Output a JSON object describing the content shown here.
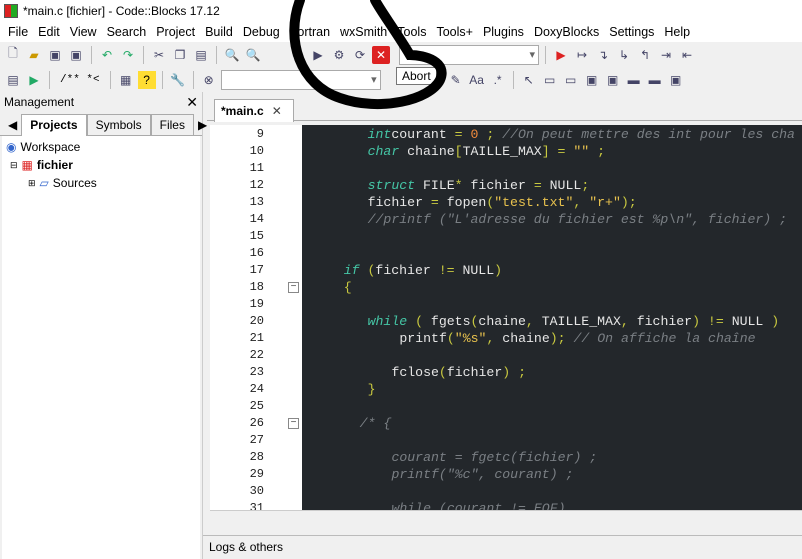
{
  "title": "*main.c [fichier] - Code::Blocks 17.12",
  "menu": [
    "File",
    "Edit",
    "View",
    "Search",
    "Project",
    "Build",
    "Debug",
    "Fortran",
    "wxSmith",
    "Tools",
    "Tools+",
    "Plugins",
    "DoxyBlocks",
    "Settings",
    "Help"
  ],
  "toolbar": {
    "doxy_comment": "/** *<",
    "tooltip": "Abort"
  },
  "management": {
    "title": "Management",
    "tabs": [
      "Projects",
      "Symbols",
      "Files"
    ],
    "tree": {
      "workspace": "Workspace",
      "project": "fichier",
      "folder": "Sources"
    }
  },
  "editor": {
    "tab": "*main.c",
    "lines": [
      {
        "n": "9",
        "indent": 8,
        "seg": [
          [
            "kw",
            "int"
          ],
          [
            "",
            "courant "
          ],
          [
            "pn",
            "= "
          ],
          [
            "num",
            "0"
          ],
          [
            "pn",
            " ; "
          ],
          [
            "com",
            "//On peut mettre des int pour les cha"
          ]
        ]
      },
      {
        "n": "10",
        "indent": 8,
        "seg": [
          [
            "kw",
            "char"
          ],
          [
            "",
            " chaine"
          ],
          [
            "pn",
            "["
          ],
          [
            "",
            "TAILLE_MAX"
          ],
          [
            "pn",
            "] = "
          ],
          [
            "str",
            "\"\""
          ],
          [
            "pn",
            " ;"
          ]
        ]
      },
      {
        "n": "11",
        "indent": 0,
        "seg": []
      },
      {
        "n": "12",
        "indent": 8,
        "seg": [
          [
            "kw",
            "struct"
          ],
          [
            "",
            " FILE"
          ],
          [
            "pn",
            "*"
          ],
          [
            "",
            " fichier "
          ],
          [
            "pn",
            "="
          ],
          [
            "",
            " NULL"
          ],
          [
            "pn",
            ";"
          ]
        ]
      },
      {
        "n": "13",
        "indent": 8,
        "seg": [
          [
            "",
            "fichier "
          ],
          [
            "pn",
            "="
          ],
          [
            "",
            " fopen"
          ],
          [
            "pn",
            "("
          ],
          [
            "str",
            "\"test.txt\""
          ],
          [
            "pn",
            ", "
          ],
          [
            "str",
            "\"r+\""
          ],
          [
            "pn",
            ");"
          ]
        ]
      },
      {
        "n": "14",
        "indent": 8,
        "seg": [
          [
            "com",
            "//printf (\"L'adresse du fichier est %p\\n\", fichier) ;"
          ]
        ]
      },
      {
        "n": "15",
        "indent": 0,
        "seg": []
      },
      {
        "n": "16",
        "indent": 0,
        "seg": []
      },
      {
        "n": "17",
        "indent": 5,
        "seg": [
          [
            "kw",
            "if"
          ],
          [
            "pn",
            " ("
          ],
          [
            "",
            "fichier "
          ],
          [
            "pn",
            "!="
          ],
          [
            "",
            " NULL"
          ],
          [
            "pn",
            ")"
          ]
        ]
      },
      {
        "n": "18",
        "indent": 5,
        "seg": [
          [
            "pn",
            "{"
          ]
        ],
        "fold": true
      },
      {
        "n": "19",
        "indent": 0,
        "seg": []
      },
      {
        "n": "20",
        "indent": 8,
        "seg": [
          [
            "kw",
            "while"
          ],
          [
            "pn",
            " ( "
          ],
          [
            "",
            "fgets"
          ],
          [
            "pn",
            "("
          ],
          [
            "",
            "chaine"
          ],
          [
            "pn",
            ", "
          ],
          [
            "",
            "TAILLE_MAX"
          ],
          [
            "pn",
            ", "
          ],
          [
            "",
            "fichier"
          ],
          [
            "pn",
            ") != "
          ],
          [
            "",
            "NULL"
          ],
          [
            "pn",
            " )"
          ]
        ]
      },
      {
        "n": "21",
        "indent": 12,
        "seg": [
          [
            "",
            "printf"
          ],
          [
            "pn",
            "("
          ],
          [
            "str",
            "\"%s\""
          ],
          [
            "pn",
            ", "
          ],
          [
            "",
            "chaine"
          ],
          [
            "pn",
            "); "
          ],
          [
            "com",
            "// On affiche la chaîne"
          ]
        ]
      },
      {
        "n": "22",
        "indent": 0,
        "seg": []
      },
      {
        "n": "23",
        "indent": 11,
        "seg": [
          [
            "",
            "fclose"
          ],
          [
            "pn",
            "("
          ],
          [
            "",
            "fichier"
          ],
          [
            "pn",
            ") ;"
          ]
        ]
      },
      {
        "n": "24",
        "indent": 8,
        "seg": [
          [
            "pn",
            "}"
          ]
        ]
      },
      {
        "n": "25",
        "indent": 0,
        "seg": []
      },
      {
        "n": "26",
        "indent": 7,
        "seg": [
          [
            "com",
            "/* {"
          ]
        ],
        "fold": true
      },
      {
        "n": "27",
        "indent": 0,
        "seg": []
      },
      {
        "n": "28",
        "indent": 11,
        "seg": [
          [
            "com",
            "courant = fgetc(fichier) ;"
          ]
        ]
      },
      {
        "n": "29",
        "indent": 11,
        "seg": [
          [
            "com",
            "printf(\"%c\", courant) ;"
          ]
        ]
      },
      {
        "n": "30",
        "indent": 0,
        "seg": []
      },
      {
        "n": "31",
        "indent": 11,
        "seg": [
          [
            "com",
            "while (courant != EOF)"
          ]
        ]
      }
    ]
  },
  "logs": {
    "title": "Logs & others"
  },
  "colors": {
    "editor_bg": "#23272b",
    "keyword": "#45c6a6",
    "string": "#e8c24e",
    "comment": "#7a7f84"
  }
}
